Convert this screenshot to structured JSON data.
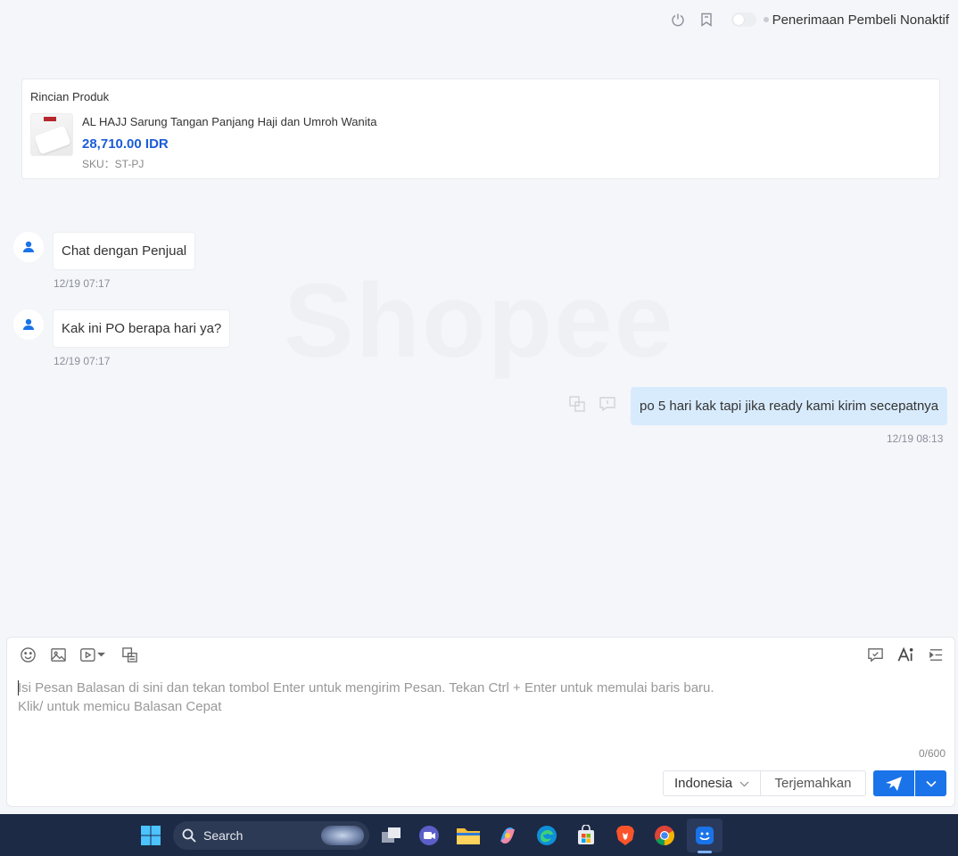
{
  "header": {
    "status_label": "Penerimaan Pembeli Nonaktif"
  },
  "product": {
    "section_title": "Rincian Produk",
    "name": "AL HAJJ Sarung Tangan Panjang Haji dan Umroh Wanita",
    "price": "28,710.00 IDR",
    "sku": "SKU：ST-PJ"
  },
  "watermark": "Shopee",
  "messages": [
    {
      "sender": "buyer",
      "text": "Chat dengan Penjual",
      "time": "12/19 07:17"
    },
    {
      "sender": "buyer",
      "text": "Kak ini PO berapa hari ya?",
      "time": "12/19 07:17"
    },
    {
      "sender": "seller",
      "text": "po 5 hari kak tapi jika ready kami kirim secepatnya",
      "time": "12/19 08:13"
    }
  ],
  "composer": {
    "placeholder_line1": "Isi Pesan Balasan di sini dan tekan tombol Enter untuk mengirim Pesan. Tekan Ctrl + Enter untuk memulai baris baru.",
    "placeholder_line2": "Klik/ untuk memicu Balasan Cepat",
    "counter": "0/600",
    "language": "Indonesia",
    "translate_label": "Terjemahkan"
  },
  "taskbar": {
    "search_label": "Search"
  },
  "colors": {
    "accent": "#1a73e8",
    "price": "#1a5dd8",
    "my_bubble": "#d8ebfd",
    "background": "#f5f6fa"
  }
}
